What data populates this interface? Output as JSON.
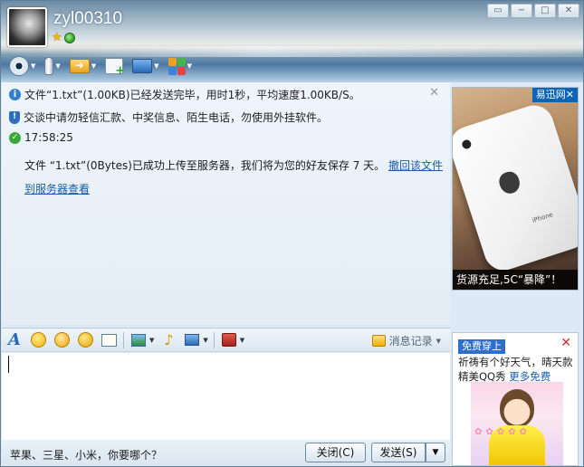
{
  "header": {
    "username": "zyl00310"
  },
  "window_controls": {
    "skin": "▭",
    "minimize": "−",
    "maximize": "□",
    "close": "✕"
  },
  "chat": {
    "notice_file_sent": "文件“1.txt”(1.00KB)已经发送完毕，用时1秒，平均速度1.00KB/S。",
    "notice_safety": "交谈中请勿轻信汇款、中奖信息、陌生电话，勿使用外挂软件。",
    "message_time": "17:58:25",
    "message_text": "文件 “1.txt”(0Bytes)已成功上传至服务器，我们将为您的好友保存 7 天。",
    "message_link_1": "撤回该文件",
    "message_link_2": "到服务器查看"
  },
  "ad_top": {
    "brand": "易迅网✕",
    "phone_label": "iPhone",
    "caption": "货源充足,5C“暴降”！"
  },
  "input_toolbar": {
    "history_label": "消息记录"
  },
  "bottom_bar": {
    "tip": "苹果、三星、小米，你要哪个？",
    "close_button": "关闭(C)",
    "send_button": "发送(S)"
  },
  "ad_bottom": {
    "tag": "免费穿上",
    "text": "祈祷有个好天气，晴天款精美QQ秀",
    "link": "更多免费"
  },
  "colors": {
    "accent_blue": "#2f6fcb",
    "link": "#1a5ca8",
    "close_red": "#d2292a"
  }
}
